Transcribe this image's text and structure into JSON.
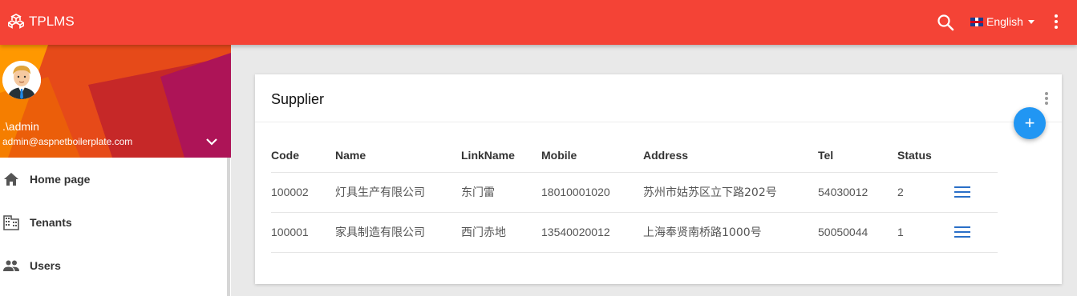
{
  "app": {
    "brand": "TPLMS",
    "language": "English",
    "icons": {
      "logo": "cubes-icon",
      "search": "search-icon",
      "more": "more-vert-icon",
      "flag": "uk-flag-icon"
    }
  },
  "colors": {
    "primary": "#f44336",
    "accent": "#2196f3",
    "row_menu": "#2a6fc7"
  },
  "sidebar": {
    "user": {
      "name": ".\\admin",
      "email": "admin@aspnetboilerplate.com"
    },
    "items": [
      {
        "label": "Home page",
        "icon": "home-icon"
      },
      {
        "label": "Tenants",
        "icon": "business-icon"
      },
      {
        "label": "Users",
        "icon": "people-icon"
      }
    ]
  },
  "card": {
    "title": "Supplier",
    "add_button": "+",
    "table": {
      "columns": [
        "Code",
        "Name",
        "LinkName",
        "Mobile",
        "Address",
        "Tel",
        "Status"
      ],
      "rows": [
        {
          "code": "100002",
          "name": "灯具生产有限公司",
          "link_name": "东门雷",
          "mobile": "18010001020",
          "address": "苏州市姑苏区立下路202号",
          "tel": "54030012",
          "status": "2"
        },
        {
          "code": "100001",
          "name": "家具制造有限公司",
          "link_name": "西门赤地",
          "mobile": "13540020012",
          "address": "上海奉贤南桥路1000号",
          "tel": "50050044",
          "status": "1"
        }
      ]
    }
  }
}
